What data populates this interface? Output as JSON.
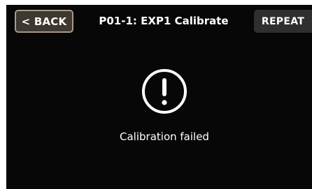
{
  "header": {
    "back_label": "< BACK",
    "title": "P01-1: EXP1 Calibrate",
    "repeat_label": "REPEAT"
  },
  "status": {
    "icon": "exclamation-circle-icon",
    "message": "Calibration failed"
  },
  "colors": {
    "background": "#070707",
    "back_button_bg": "#3d3830",
    "back_button_border": "#a79a86",
    "repeat_button_bg": "#2f2f2f",
    "text": "#ffffff"
  }
}
